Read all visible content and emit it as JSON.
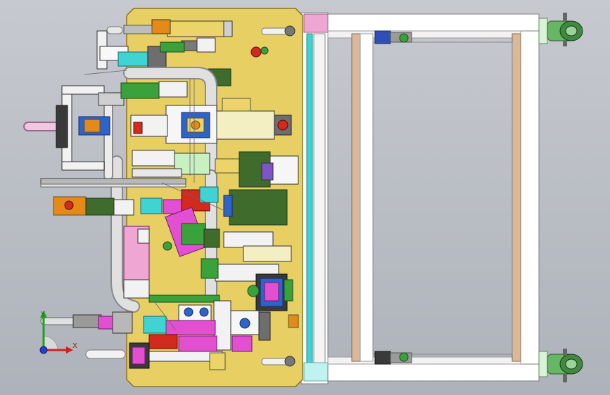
{
  "triad": {
    "x_label": "X",
    "y_label": "Y"
  },
  "colors": {
    "plate": "#e7cf63",
    "plate_edge": "#8a7420",
    "frame": "#ffffff",
    "frame_edge": "#7d7d7d",
    "wood": "#d9b99a",
    "tube": "#d4d4d4",
    "green": "#3aa23a",
    "dark_green": "#3f6b2c",
    "cyan": "#3fd3d3",
    "blue": "#2f63c8",
    "magenta": "#e24fd0",
    "orange": "#e58a18",
    "red": "#d22a1c",
    "pink": "#f0a6d2",
    "purple": "#7c56c9",
    "wheel": "#66b666",
    "axis_x": "#d22020",
    "axis_y": "#20a020",
    "axis_z": "#2040d0"
  }
}
